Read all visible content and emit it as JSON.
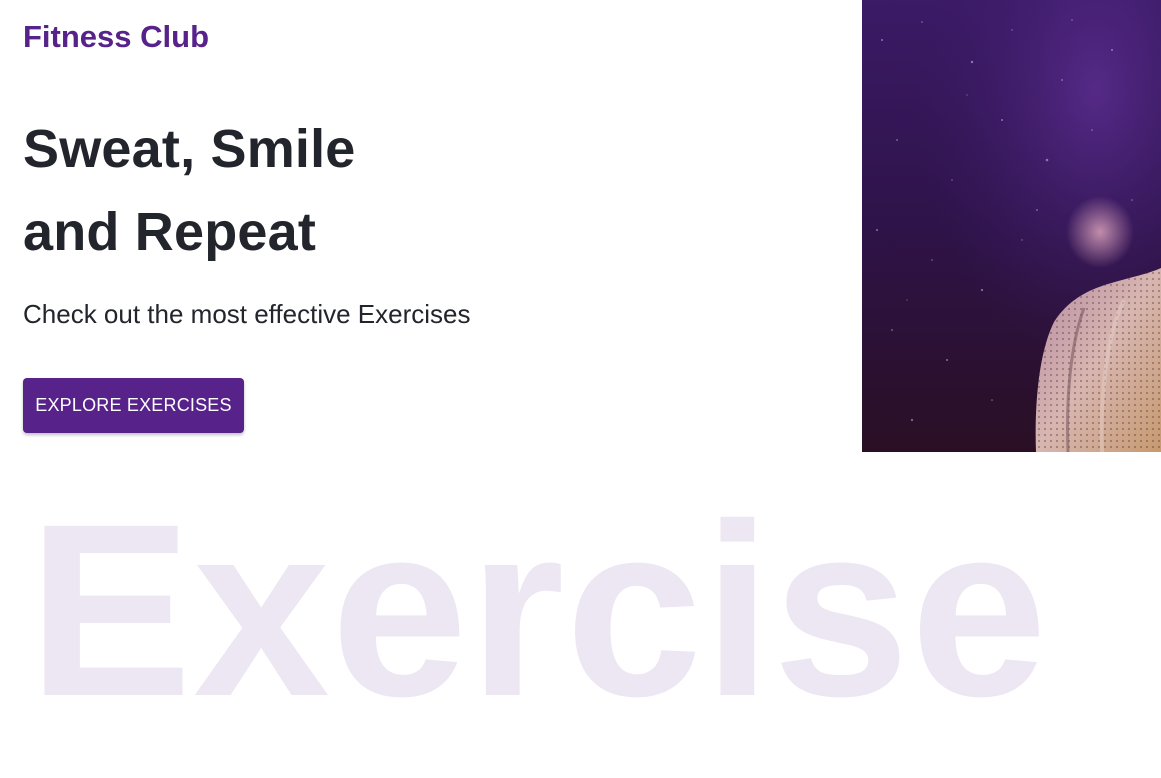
{
  "brand": {
    "name": "Fitness Club",
    "color": "#57238a"
  },
  "hero": {
    "headline_line1": "Sweat, Smile",
    "headline_line2": "and Repeat",
    "subtitle": "Check out the most effective Exercises",
    "cta_label": "EXPLORE EXERCISES",
    "image_icon": "athlete-photo"
  },
  "watermark": {
    "text": "Exercise",
    "color": "#ede7f3"
  }
}
